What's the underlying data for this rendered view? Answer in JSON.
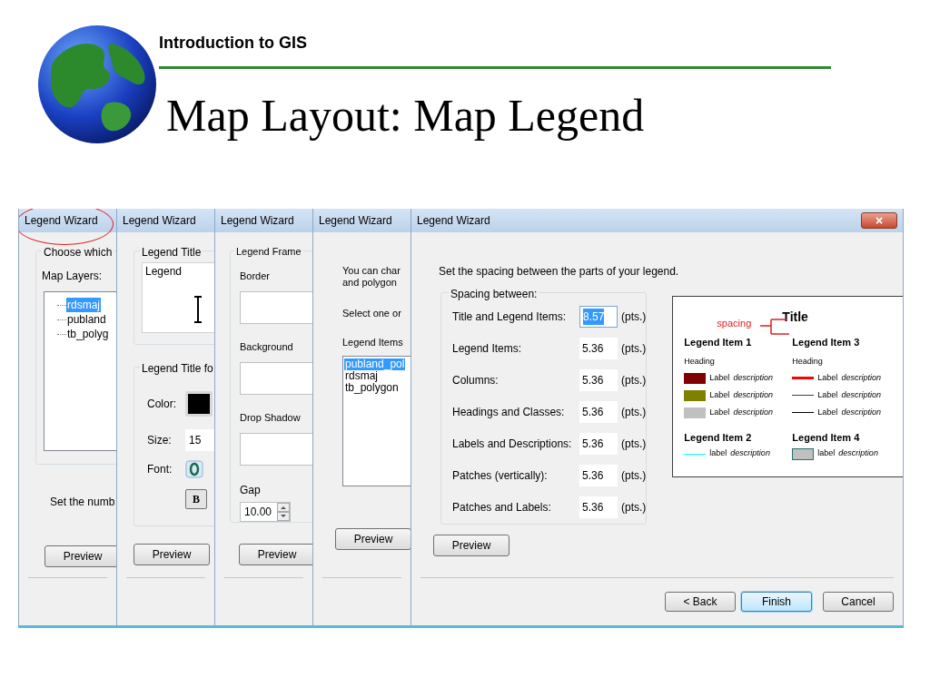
{
  "slide": {
    "course": "Introduction to GIS",
    "title": "Map Layout: Map Legend"
  },
  "windows": [
    {
      "kind": "layers",
      "title": "Legend Wizard",
      "circled": true,
      "group_label": "Choose which",
      "layers_label": "Map Layers:",
      "layers": [
        {
          "name": "rdsmaj",
          "selected": true
        },
        {
          "name": "publand",
          "selected": false
        },
        {
          "name": "tb_polyg",
          "selected": false
        }
      ],
      "note": "Set the numb",
      "preview_button": "Preview"
    },
    {
      "kind": "title",
      "title": "Legend Wizard",
      "circled": false,
      "title_label": "Legend Title",
      "title_value": "Legend",
      "font_group_label": "Legend Title fo",
      "color_label": "Color:",
      "size_label": "Size:",
      "size_value": "15",
      "font_label": "Font:",
      "bold_button": "B",
      "preview_button": "Preview"
    },
    {
      "kind": "frame",
      "title": "Legend Wizard",
      "circled": false,
      "group_label": "Legend Frame",
      "fields": [
        "Border",
        "Background",
        "Drop Shadow"
      ],
      "gap_label": "Gap",
      "gap_value": "10.00",
      "preview_button": "Preview"
    },
    {
      "kind": "items",
      "title": "Legend Wizard",
      "circled": false,
      "intro": [
        "You can char",
        "and polygon"
      ],
      "select_text": "Select one or",
      "items_label": "Legend Items",
      "items": [
        {
          "name": "publand_pol",
          "selected": true
        },
        {
          "name": "rdsmaj",
          "selected": false
        },
        {
          "name": "tb_polygon",
          "selected": false
        }
      ],
      "preview_button": "Preview"
    },
    {
      "kind": "spacing",
      "title": "Legend Wizard",
      "circled": false,
      "intro": "Set the spacing between the parts of your legend.",
      "group_label": "Spacing between:",
      "rows": [
        {
          "label": "Title and Legend Items:",
          "value": "8.57",
          "unit": "(pts.)",
          "selected": true
        },
        {
          "label": "Legend Items:",
          "value": "5.36",
          "unit": "(pts.)",
          "selected": false
        },
        {
          "label": "Columns:",
          "value": "5.36",
          "unit": "(pts.)",
          "selected": false
        },
        {
          "label": "Headings and Classes:",
          "value": "5.36",
          "unit": "(pts.)",
          "selected": false
        },
        {
          "label": "Labels and Descriptions:",
          "value": "5.36",
          "unit": "(pts.)",
          "selected": false
        },
        {
          "label": "Patches (vertically):",
          "value": "5.36",
          "unit": "(pts.)",
          "selected": false
        },
        {
          "label": "Patches and Labels:",
          "value": "5.36",
          "unit": "(pts.)",
          "selected": false
        }
      ],
      "legend_preview": {
        "title": "Title",
        "spacing_label": "spacing",
        "items": [
          {
            "heading": "Legend Item 1",
            "subheading": "Heading",
            "classes": [
              {
                "kind": "patch",
                "color": "#800000",
                "label": "Label",
                "description": "description"
              },
              {
                "kind": "patch",
                "color": "#808000",
                "label": "Label",
                "description": "description"
              },
              {
                "kind": "patch",
                "color": "#c0c0c0",
                "label": "Label",
                "description": "description"
              }
            ]
          },
          {
            "heading": "Legend Item 3",
            "subheading": "Heading",
            "classes": [
              {
                "kind": "thick-line",
                "color": "#ff0000",
                "label": "Label",
                "description": "description"
              },
              {
                "kind": "line",
                "color": "#404040",
                "label": "Label",
                "description": "description"
              },
              {
                "kind": "line",
                "color": "#000000",
                "label": "Label",
                "description": "description"
              }
            ]
          },
          {
            "heading": "Legend Item 2",
            "classes": [
              {
                "kind": "line",
                "color": "#00ffff",
                "label": "label",
                "description": "description"
              }
            ]
          },
          {
            "heading": "Legend Item 4",
            "classes": [
              {
                "kind": "outlined-patch",
                "color": "#c0c0c0",
                "label": "label",
                "description": "description"
              }
            ]
          }
        ]
      },
      "preview_button": "Preview",
      "close_button": "×",
      "buttons": [
        {
          "label": "< Back",
          "default": false
        },
        {
          "label": "Finish",
          "default": true
        },
        {
          "label": "Cancel",
          "default": false
        }
      ]
    }
  ]
}
